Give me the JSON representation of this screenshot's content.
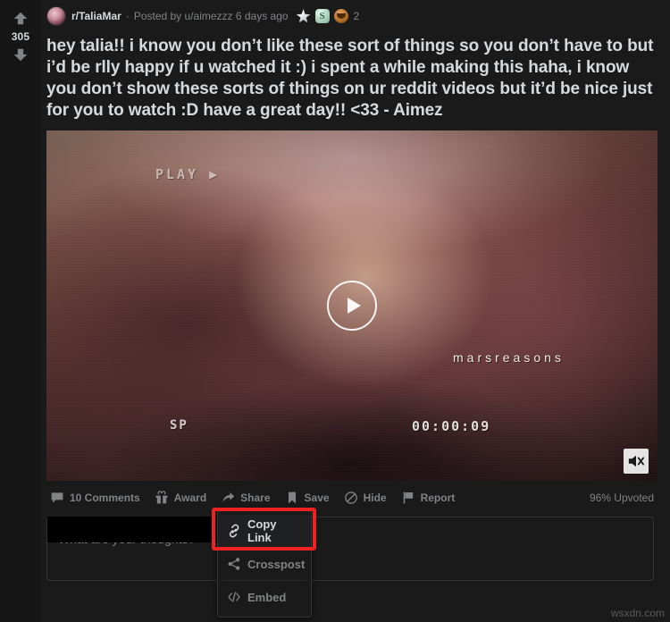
{
  "post": {
    "vote": {
      "upvote_icon": "upvote-arrow-icon",
      "downvote_icon": "downvote-arrow-icon",
      "score": "305"
    },
    "header": {
      "subreddit": "r/TaliaMar",
      "separator": "·",
      "posted_by": "Posted by u/aimezzz 6 days ago",
      "awards": [
        {
          "icon": "silver-award-icon",
          "label": "Silver"
        },
        {
          "icon": "snek-award-icon",
          "label": "S"
        },
        {
          "icon": "wholesome-award-icon",
          "label": "Wholesome"
        }
      ],
      "award_count": "2"
    },
    "title": "hey talia!! i know you don’t like these sort of things so you don’t have to but i’d be rlly happy if u watched it :) i spent a while making this haha, i know you don’t show these sorts of things on ur reddit videos but it’d be nice just for you to watch :D have a great day!! <33 - Aimez",
    "video": {
      "play_label": "PLAY ▶",
      "mode_label": "SP",
      "timecode": "00:00:09",
      "watermark": "marsreasons",
      "play_button_icon": "play-triangle-icon",
      "mute_button_icon": "speaker-mute-icon"
    },
    "actions": [
      {
        "icon": "comment-bubble-icon",
        "label": "10 Comments"
      },
      {
        "icon": "gift-icon",
        "label": "Award"
      },
      {
        "icon": "share-arrow-icon",
        "label": "Share"
      },
      {
        "icon": "bookmark-icon",
        "label": "Save"
      },
      {
        "icon": "hide-circle-slash-icon",
        "label": "Hide"
      },
      {
        "icon": "flag-icon",
        "label": "Report"
      }
    ],
    "upvoted_percent": "96% Upvoted"
  },
  "composer": {
    "placeholder": "What are your thoughts?"
  },
  "share_menu": {
    "items": [
      {
        "icon": "link-chain-icon",
        "label": "Copy Link",
        "active": true
      },
      {
        "icon": "crosspost-share-icon",
        "label": "Crosspost",
        "active": false
      },
      {
        "icon": "embed-code-icon",
        "label": "Embed",
        "active": false
      }
    ]
  },
  "highlight": {
    "color": "#ee2222",
    "target": "Copy Link"
  },
  "watermark": "wsxdn.com",
  "theme": {
    "background": "#1a1a1b",
    "text": "#d7dadc",
    "muted": "#818384",
    "border": "#343536"
  }
}
